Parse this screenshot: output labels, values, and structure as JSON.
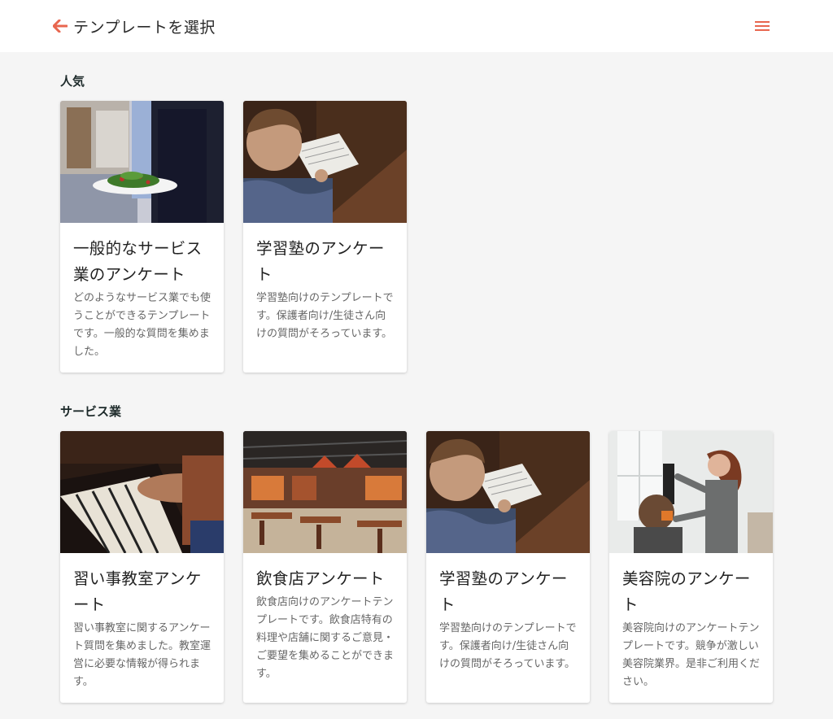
{
  "header": {
    "title": "テンプレートを選択",
    "back_icon": "arrow-left-icon",
    "menu_icon": "hamburger-menu-icon",
    "accent_color": "#e8664f"
  },
  "sections": [
    {
      "title": "人気",
      "cards": [
        {
          "title": "一般的なサービス業のアンケート",
          "description": "どのようなサービス業でも使うことができるテンプレートです。一般的な質問を集めました。"
        },
        {
          "title": "学習塾のアンケート",
          "description": "学習塾向けのテンプレートです。保護者向け/生徒さん向けの質問がそろっています。"
        }
      ]
    },
    {
      "title": "サービス業",
      "cards": [
        {
          "title": "習い事教室アンケート",
          "description": "習い事教室に関するアンケート質問を集めました。教室運営に必要な情報が得られます。"
        },
        {
          "title": "飲食店アンケート",
          "description": "飲食店向けのアンケートテンプレートです。飲食店特有の料理や店舗に関するご意見・ご要望を集めることができます。"
        },
        {
          "title": "学習塾のアンケート",
          "description": "学習塾向けのテンプレートです。保護者向け/生徒さん向けの質問がそろっています。"
        },
        {
          "title": "美容院のアンケート",
          "description": "美容院向けのアンケートテンプレートです。競争が激しい美容院業界。是非ご利用ください。"
        }
      ]
    }
  ]
}
